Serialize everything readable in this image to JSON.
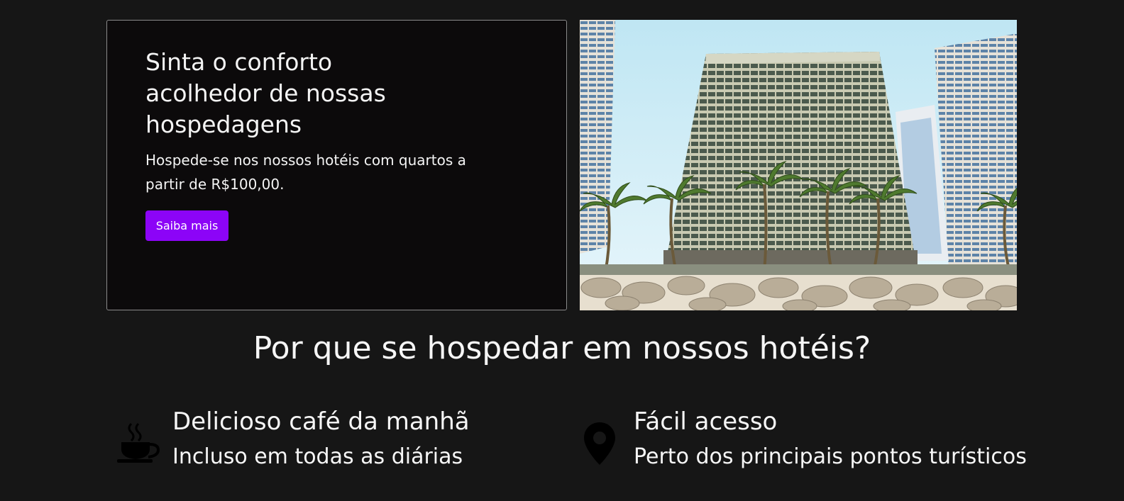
{
  "hero": {
    "title": "Sinta o conforto acolhedor de nossas hospedagens",
    "description": "Hospede-se nos nossos hotéis com quartos a partir de R$100,00.",
    "button_label": "Saiba mais",
    "accent_color": "#8c04f7"
  },
  "why_section": {
    "title": "Por que se hospedar em nossos hotéis?"
  },
  "features": [
    {
      "icon": "coffee-cup-icon",
      "title": "Delicioso café da manhã",
      "text": "Incluso em todas as diárias"
    },
    {
      "icon": "map-pin-icon",
      "title": "Fácil acesso",
      "text": "Perto dos principais pontos turísticos"
    }
  ]
}
